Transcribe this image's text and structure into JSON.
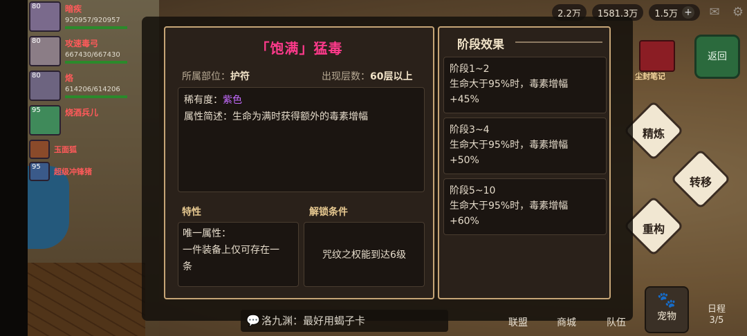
{
  "hud": {
    "currency_1": "2.2万",
    "currency_2": "1581.3万",
    "currency_3": "1.5万",
    "plus": "+",
    "mail_icon": "mail-icon",
    "settings_icon": "gear-icon"
  },
  "party": [
    {
      "level": "80",
      "name": "暗疾",
      "hp": "920957/920957"
    },
    {
      "level": "80",
      "name": "攻速毒弓",
      "hp": "667430/667430"
    },
    {
      "level": "80",
      "name": "烙",
      "hp": "614206/614206"
    },
    {
      "level": "95",
      "name": "烧酒兵儿",
      "hp": ""
    },
    {
      "level": "",
      "name": "玉面狐",
      "hp": ""
    },
    {
      "level": "95",
      "name": "超级冲锋猪",
      "hp": ""
    }
  ],
  "item": {
    "title": "「饱满」猛毒",
    "slot_label": "所属部位：",
    "slot_value": "护符",
    "floor_label": "出现层数：",
    "floor_value": "60层以上",
    "rarity_label": "稀有度：",
    "rarity_value": "紫色",
    "desc_label": "属性简述：",
    "desc_value": "生命为满时获得额外的毒素增幅",
    "trait_title": "特性",
    "trait_line1": "唯一属性：",
    "trait_line2": "一件装备上仅可存在一",
    "trait_line3": "条",
    "unlock_title": "解锁条件",
    "unlock_value": "咒纹之权能到达6级"
  },
  "stages": {
    "header": "阶段效果",
    "items": [
      {
        "name": "阶段1~2",
        "desc": "生命大于95%时，毒素增幅",
        "value": "+45%"
      },
      {
        "name": "阶段3~4",
        "desc": "生命大于95%时，毒素增幅",
        "value": "+50%"
      },
      {
        "name": "阶段5~10",
        "desc": "生命大于95%时，毒素增幅",
        "value": "+60%"
      }
    ]
  },
  "side_menu": {
    "back": "返回",
    "chest_label": "尘封笔记",
    "refine": "精炼",
    "transfer": "转移",
    "rebuild": "重构"
  },
  "bottom": {
    "chat_text": "洛九渊：最好用蝎子卡",
    "nav": [
      "联盟",
      "商城",
      "队伍"
    ],
    "pet": "宠物",
    "schedule": "日程",
    "schedule_count": "3/5"
  }
}
